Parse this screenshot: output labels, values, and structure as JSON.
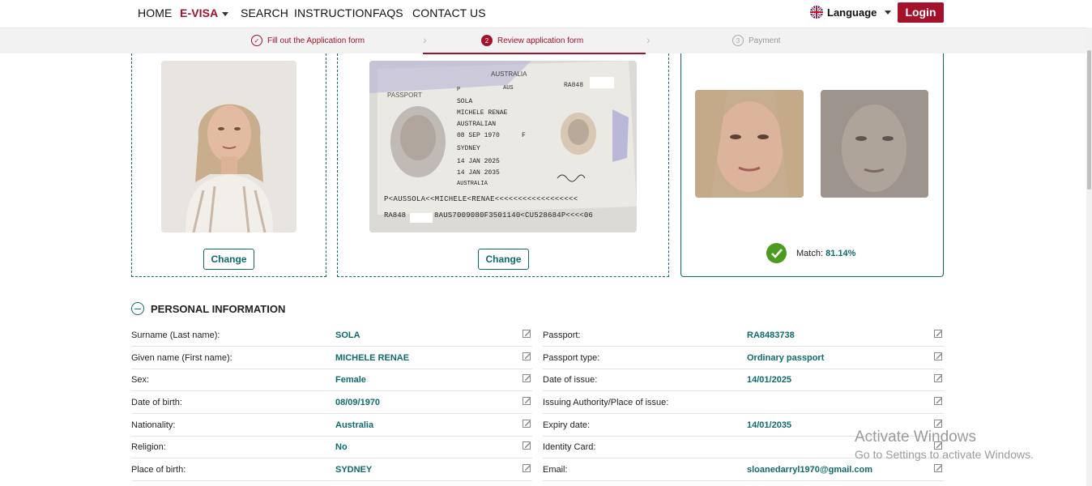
{
  "nav": {
    "items": [
      "HOME",
      "E-VISA",
      "SEARCH",
      "INSTRUCTION",
      "FAQS",
      "CONTACT US"
    ],
    "language_label": "Language",
    "login_label": "Login"
  },
  "steps": [
    {
      "num": "✓",
      "label": "Fill out the Application form",
      "state": "done"
    },
    {
      "num": "2",
      "label": "Review application form",
      "state": "active"
    },
    {
      "num": "3",
      "label": "Payment",
      "state": "pending"
    }
  ],
  "cards": {
    "change_label": "Change",
    "match_label": "Match:",
    "match_value": "81.14%"
  },
  "passport_image": {
    "country": "AUSTRALIA",
    "header_label": "PASSPORT",
    "type": "P",
    "code": "AUS",
    "number": "RA848",
    "surname": "SOLA",
    "given": "MICHELE RENAE",
    "nationality": "AUSTRALIAN",
    "dob": "08 SEP 1970",
    "sex": "F",
    "pob": "SYDNEY",
    "issue": "14 JAN 2025",
    "expiry": "14 JAN 2035",
    "authority": "AUSTRALIA",
    "mrz1": "P<AUSSOLA<<MICHELE<RENAE<<<<<<<<<<<<<<<<<<",
    "mrz2a": "RA848",
    "mrz2b": "8AUS7009080F3501140<CU528684P<<<<06"
  },
  "personal": {
    "title": "PERSONAL INFORMATION",
    "left": [
      {
        "label": "Surname (Last name):",
        "value": "SOLA"
      },
      {
        "label": "Given name (First name):",
        "value": "MICHELE RENAE"
      },
      {
        "label": "Sex:",
        "value": "Female"
      },
      {
        "label": "Date of birth:",
        "value": "08/09/1970"
      },
      {
        "label": "Nationality:",
        "value": "Australia"
      },
      {
        "label": "Religion:",
        "value": "No"
      },
      {
        "label": "Place of birth:",
        "value": "SYDNEY"
      }
    ],
    "right": [
      {
        "label": "Passport:",
        "value": "RA8483738"
      },
      {
        "label": "Passport type:",
        "value": "Ordinary passport"
      },
      {
        "label": "Date of issue:",
        "value": "14/01/2025"
      },
      {
        "label": "Issuing Authority/Place of issue:",
        "value": ""
      },
      {
        "label": "Expiry date:",
        "value": "14/01/2035"
      },
      {
        "label": "Identity Card:",
        "value": ""
      },
      {
        "label": "Email:",
        "value": "sloanedarryl1970@gmail.com"
      }
    ]
  },
  "watermark": {
    "line1": "Activate Windows",
    "line2": "Go to Settings to activate Windows."
  }
}
